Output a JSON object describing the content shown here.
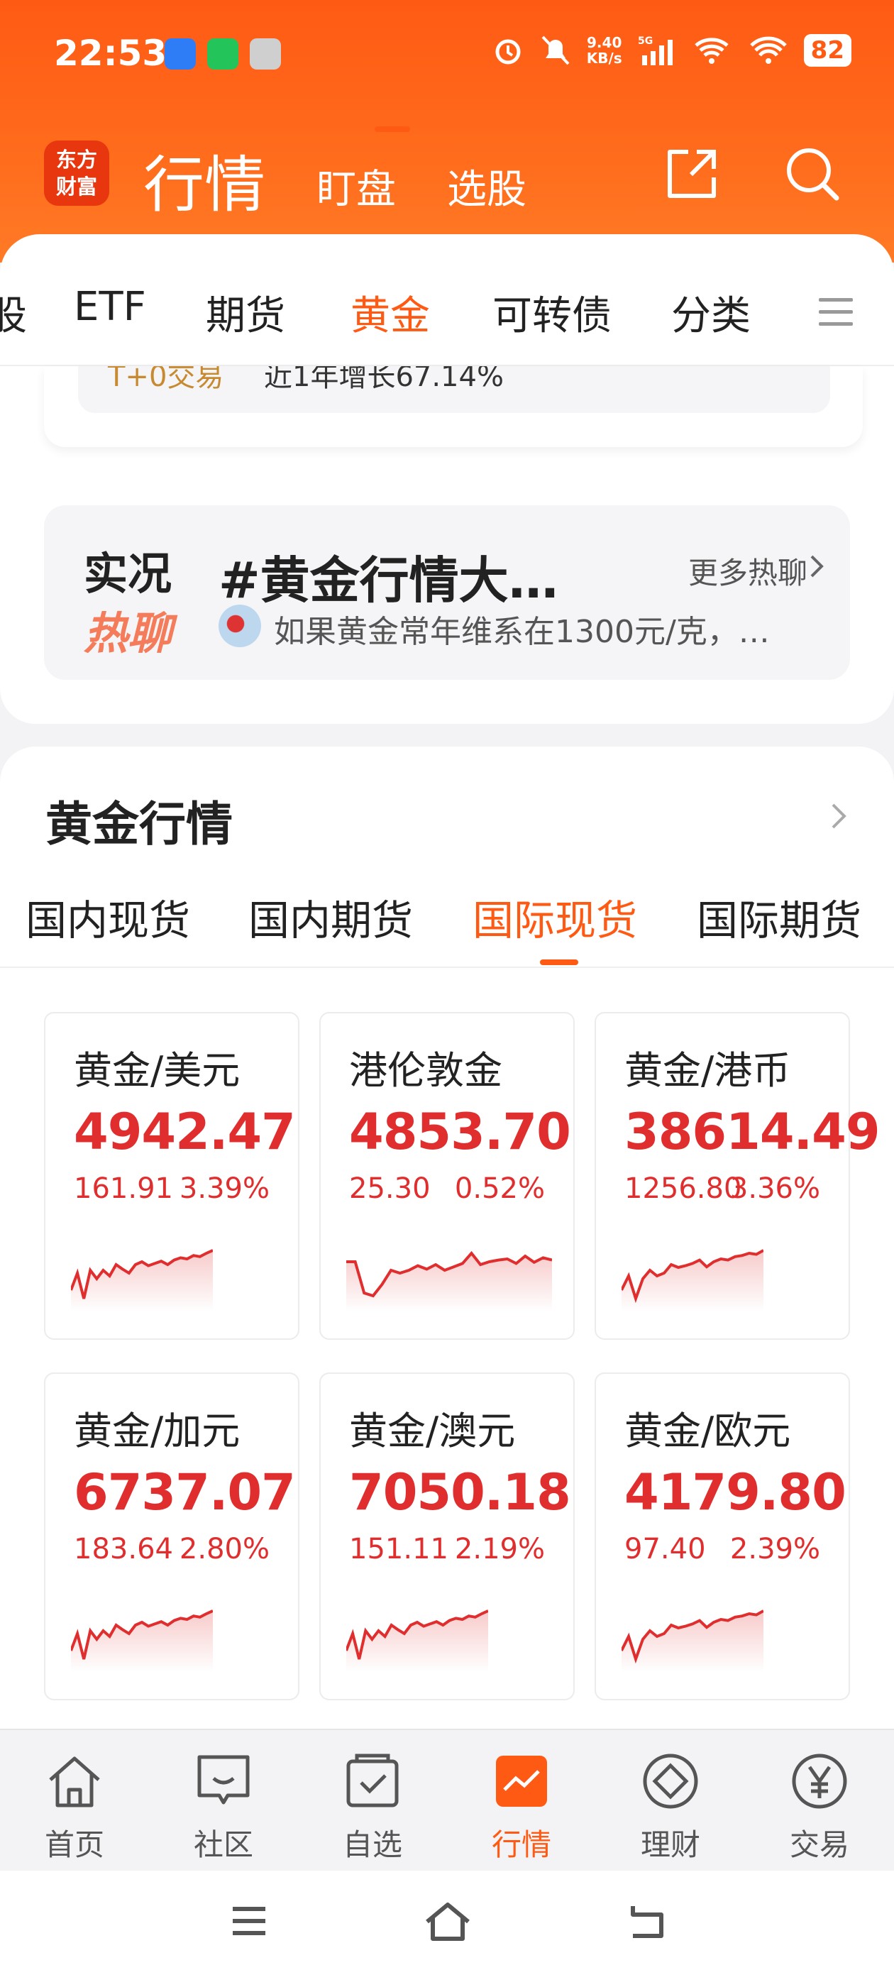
{
  "status_bar": {
    "time": "22:53",
    "net_speed_top": "9.40",
    "net_speed_bottom": "KB/s",
    "net_type": "5G",
    "battery": "82"
  },
  "header": {
    "logo_line1": "东方",
    "logo_line2": "财富",
    "title": "行情",
    "tabs": [
      "盯盘",
      "选股"
    ]
  },
  "market_tabs": [
    {
      "label": "股",
      "active": false
    },
    {
      "label": "ETF",
      "active": false
    },
    {
      "label": "期货",
      "active": false
    },
    {
      "label": "黄金",
      "active": true
    },
    {
      "label": "可转债",
      "active": false
    },
    {
      "label": "分类",
      "active": false
    }
  ],
  "partial_card": {
    "tag": "T+0交易",
    "text": "近1年增长67.14%"
  },
  "hot_chat": {
    "label_line1": "实况",
    "label_line2": "热聊",
    "topic": "#黄金行情大…",
    "more": "更多热聊",
    "message": "如果黄金常年维系在1300元/克，…"
  },
  "gold": {
    "title": "黄金行情",
    "subtabs": [
      {
        "label": "国内现货",
        "active": false
      },
      {
        "label": "国内期货",
        "active": false
      },
      {
        "label": "国际现货",
        "active": true
      },
      {
        "label": "国际期货",
        "active": false
      }
    ],
    "cards": [
      {
        "name": "黄金/美元",
        "price": "4942.47",
        "change": "161.91",
        "pct": "3.39%"
      },
      {
        "name": "港伦敦金",
        "price": "4853.70",
        "change": "25.30",
        "pct": "0.52%"
      },
      {
        "name": "黄金/港币",
        "price": "38614.49",
        "change": "1256.80",
        "pct": "3.36%"
      },
      {
        "name": "黄金/加元",
        "price": "6737.07",
        "change": "183.64",
        "pct": "2.80%"
      },
      {
        "name": "黄金/澳元",
        "price": "7050.18",
        "change": "151.11",
        "pct": "2.19%"
      },
      {
        "name": "黄金/欧元",
        "price": "4179.80",
        "change": "97.40",
        "pct": "2.39%"
      }
    ]
  },
  "bottom_nav": [
    {
      "label": "首页",
      "icon": "home-icon",
      "active": false
    },
    {
      "label": "社区",
      "icon": "community-icon",
      "active": false
    },
    {
      "label": "自选",
      "icon": "watchlist-icon",
      "active": false
    },
    {
      "label": "行情",
      "icon": "market-icon",
      "active": true
    },
    {
      "label": "理财",
      "icon": "wealth-icon",
      "active": false
    },
    {
      "label": "交易",
      "icon": "trade-icon",
      "active": false
    }
  ],
  "colors": {
    "brand_orange": "#ff5a14",
    "up_red": "#e02e2e"
  }
}
